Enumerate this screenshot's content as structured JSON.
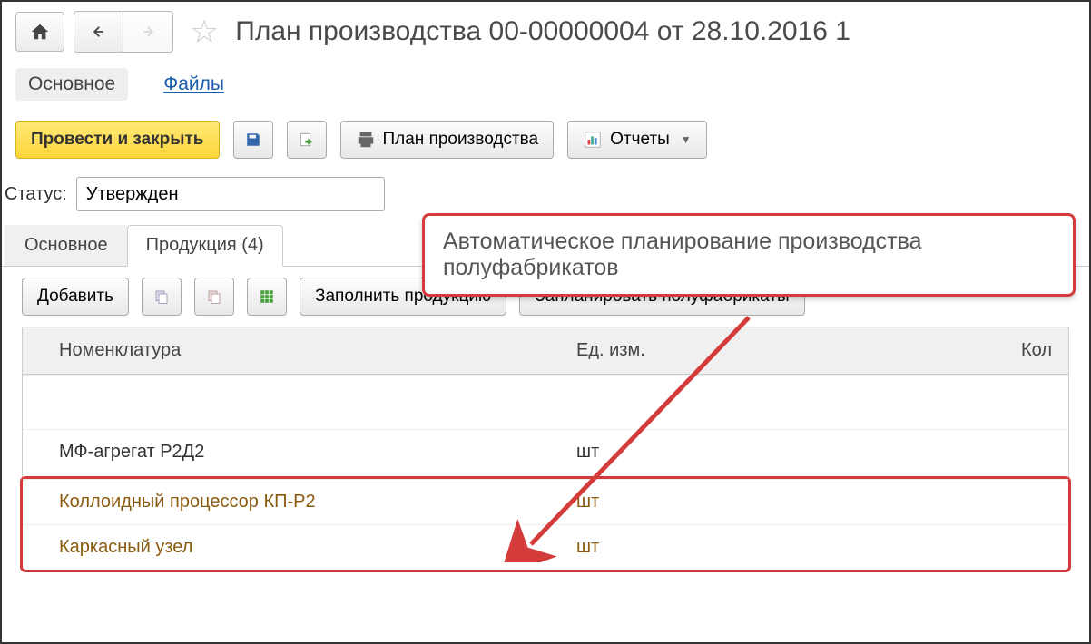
{
  "title": "План производства 00-00000004 от 28.10.2016 1",
  "mainTabs": {
    "main": "Основное",
    "files": "Файлы"
  },
  "toolbar": {
    "submit": "Провести и закрыть",
    "printPlan": "План производства",
    "reports": "Отчеты"
  },
  "status": {
    "label": "Статус:",
    "value": "Утвержден"
  },
  "callout": "Автоматическое планирование производства полуфабрикатов",
  "subTabs": {
    "main": "Основное",
    "products": "Продукция (4)"
  },
  "tableToolbar": {
    "add": "Добавить",
    "fillProducts": "Заполнить продукцию",
    "planSemis": "Запланировать полуфабрикаты"
  },
  "columns": {
    "nomenclature": "Номенклатура",
    "unit": "Ед. изм.",
    "qty": "Кол"
  },
  "rows": [
    {
      "name": "МФ-агрегат Р2Д2",
      "unit": "шт",
      "highlight": false
    },
    {
      "name": "Коллоидный процессор КП-Р2",
      "unit": "шт",
      "highlight": true
    },
    {
      "name": "Каркасный узел",
      "unit": "шт",
      "highlight": true
    }
  ]
}
